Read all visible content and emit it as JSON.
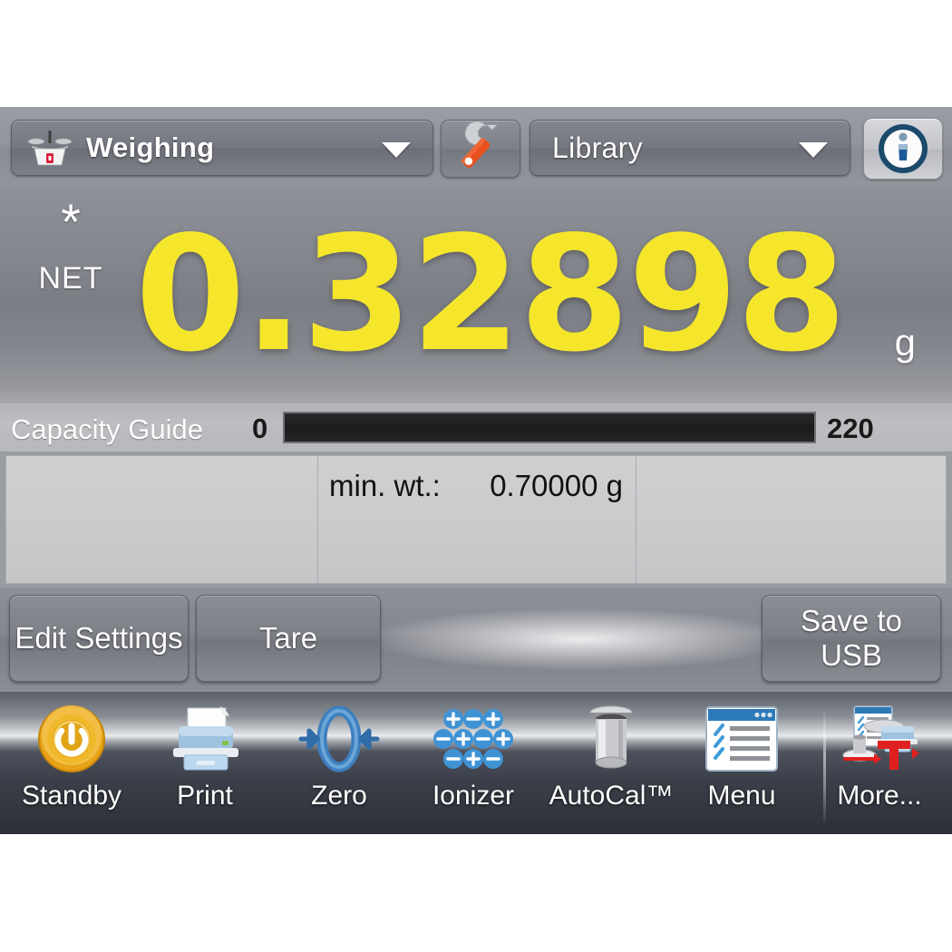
{
  "header": {
    "mode_selector": {
      "label": "Weighing",
      "icon": "balance-scale-icon",
      "caret": "chevron-down-icon"
    },
    "settings_button": {
      "icon": "wrench-icon"
    },
    "library_selector": {
      "label": "Library",
      "caret": "chevron-down-icon"
    },
    "info_button": {
      "icon": "info-icon"
    }
  },
  "display": {
    "stability_indicator": "*",
    "net_indicator": "NET",
    "value": "0.32898",
    "unit": "g",
    "value_color": "#f5e62b"
  },
  "capacity": {
    "label": "Capacity Guide",
    "min": "0",
    "max": "220",
    "fill_percent": 0
  },
  "info_panels": [
    {
      "key": "",
      "value": ""
    },
    {
      "key": "min. wt.:",
      "value": "0.70000 g"
    },
    {
      "key": "",
      "value": ""
    }
  ],
  "actions": {
    "edit_settings": "Edit Settings",
    "tare": "Tare",
    "save_to_usb_line1": "Save to",
    "save_to_usb_line2": "USB"
  },
  "toolbar": [
    {
      "label": "Standby",
      "icon": "power-standby-icon"
    },
    {
      "label": "Print",
      "icon": "printer-icon"
    },
    {
      "label": "Zero",
      "icon": "zero-arrows-icon"
    },
    {
      "label": "Ionizer",
      "icon": "ionizer-icon"
    },
    {
      "label": "AutoCal™",
      "icon": "calibration-weight-icon"
    },
    {
      "label": "Menu",
      "icon": "menu-window-icon"
    },
    {
      "label": "More...",
      "icon": "more-options-icon"
    }
  ]
}
